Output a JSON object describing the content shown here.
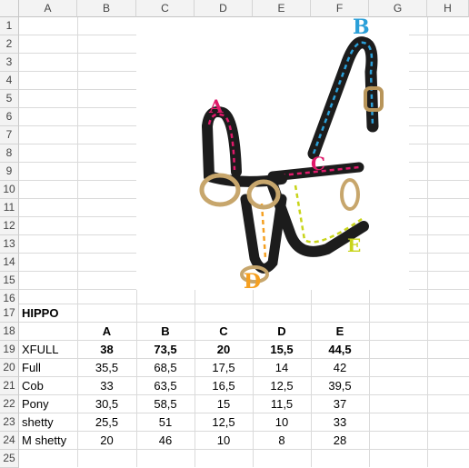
{
  "columns": [
    "A",
    "B",
    "C",
    "D",
    "E",
    "F",
    "G",
    "H"
  ],
  "rows": [
    "1",
    "2",
    "3",
    "4",
    "5",
    "6",
    "7",
    "8",
    "9",
    "10",
    "11",
    "12",
    "13",
    "14",
    "15",
    "16",
    "17",
    "18",
    "19",
    "20",
    "21",
    "22",
    "23",
    "24",
    "25"
  ],
  "image": {
    "labels": {
      "a": "A",
      "b": "B",
      "c": "C",
      "d": "D",
      "e": "E"
    },
    "colors": {
      "a": "#e0196a",
      "b": "#2a9fd8",
      "c": "#e0196a",
      "d": "#f5a021",
      "e": "#c8d41a"
    }
  },
  "table": {
    "title": "HIPPO",
    "headers": [
      "A",
      "B",
      "C",
      "D",
      "E"
    ],
    "rows": [
      {
        "name": "XFULL",
        "values": [
          "38",
          "73,5",
          "20",
          "15,5",
          "44,5"
        ],
        "bold": true
      },
      {
        "name": "Full",
        "values": [
          "35,5",
          "68,5",
          "17,5",
          "14",
          "42"
        ],
        "bold": false
      },
      {
        "name": "Cob",
        "values": [
          "33",
          "63,5",
          "16,5",
          "12,5",
          "39,5"
        ],
        "bold": false
      },
      {
        "name": "Pony",
        "values": [
          "30,5",
          "58,5",
          "15",
          "11,5",
          "37"
        ],
        "bold": false
      },
      {
        "name": "shetty",
        "values": [
          "25,5",
          "51",
          "12,5",
          "10",
          "33"
        ],
        "bold": false
      },
      {
        "name": "M shetty",
        "values": [
          "20",
          "46",
          "10",
          "8",
          "28"
        ],
        "bold": false
      }
    ]
  }
}
